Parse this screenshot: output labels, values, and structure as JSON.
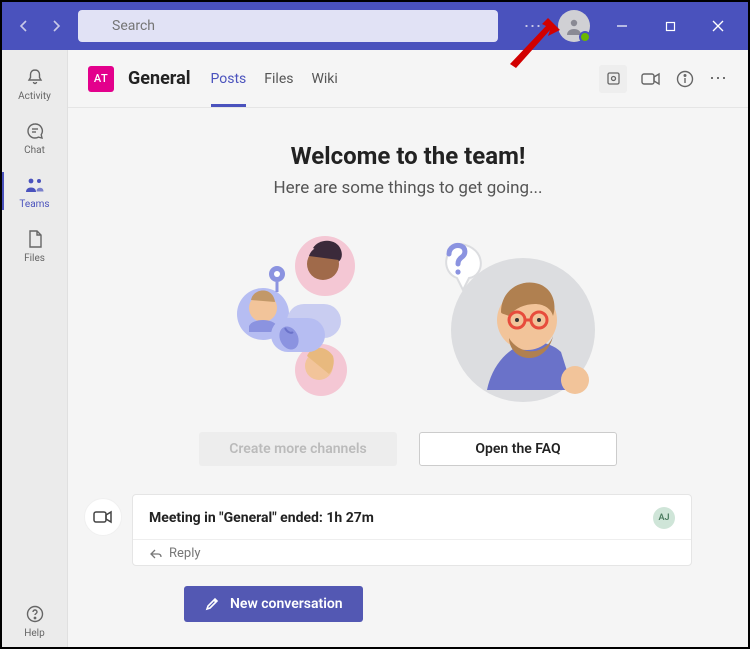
{
  "titlebar": {
    "search_placeholder": "Search"
  },
  "rail": {
    "items": [
      {
        "label": "Activity"
      },
      {
        "label": "Chat"
      },
      {
        "label": "Teams"
      },
      {
        "label": "Files"
      }
    ],
    "help": "Help"
  },
  "channel": {
    "team_initials": "AT",
    "name": "General",
    "tabs": [
      {
        "label": "Posts"
      },
      {
        "label": "Files"
      },
      {
        "label": "Wiki"
      }
    ]
  },
  "welcome": {
    "title": "Welcome to the team!",
    "subtitle": "Here are some things to get going...",
    "create_channels": "Create more channels",
    "open_faq": "Open the FAQ"
  },
  "post": {
    "title": "Meeting in \"General\" ended: 1h 27m",
    "attendee_initials": "AJ",
    "reply": "Reply"
  },
  "compose": {
    "new_conversation": "New conversation"
  }
}
